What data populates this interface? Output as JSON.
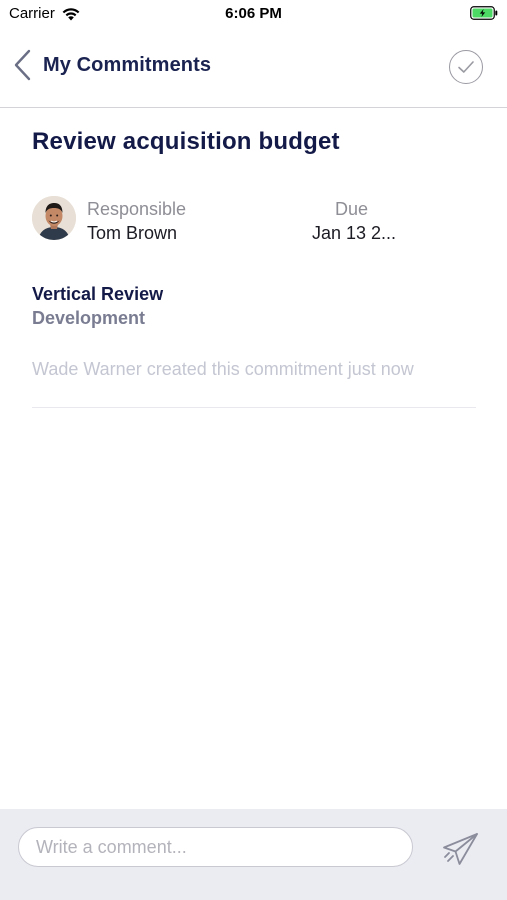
{
  "status_bar": {
    "carrier": "Carrier",
    "time": "6:06 PM"
  },
  "nav": {
    "back_label": "My Commitments",
    "back_icon": "chevron-left-icon",
    "complete_icon": "checkmark-circle-icon"
  },
  "commitment": {
    "title": "Review acquisition budget",
    "responsible_label": "Responsible",
    "responsible_name": "Tom Brown",
    "due_label": "Due",
    "due_value": "Jan 13 2...",
    "project": "Vertical Review",
    "project_sub": "Development",
    "activity": "Wade Warner created this commitment just now"
  },
  "comment": {
    "placeholder": "Write a comment...",
    "send_icon": "paper-plane-icon"
  },
  "colors": {
    "navy": "#1b2350",
    "battery_green": "#4cd964",
    "bottom_bar": "#ebebf2"
  }
}
